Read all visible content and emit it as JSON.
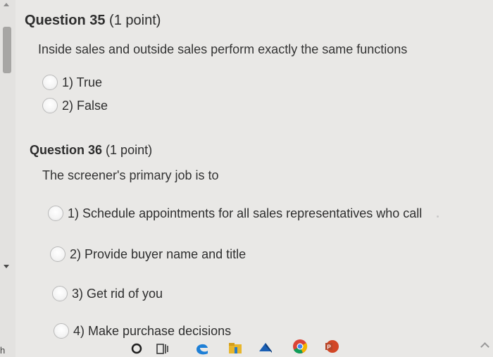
{
  "q35": {
    "title": "Question 35",
    "points": "(1 point)",
    "text": "Inside sales and outside sales perform exactly the same functions",
    "options": [
      {
        "label": "1) True"
      },
      {
        "label": "2) False"
      }
    ]
  },
  "q36": {
    "title": "Question 36",
    "points": "(1 point)",
    "text": "The screener's primary job is to",
    "options": [
      {
        "label": "1) Schedule appointments for all sales representatives who call"
      },
      {
        "label": "2) Provide buyer name and title"
      },
      {
        "label": "3) Get rid of you"
      },
      {
        "label": "4) Make purchase decisions"
      }
    ]
  },
  "edge_text": "h",
  "taskbar": {
    "icons": [
      "cortana-search-icon",
      "task-view-icon",
      "edge-icon",
      "file-explorer-icon",
      "mail-icon",
      "chrome-icon",
      "powerpoint-icon"
    ],
    "colors": {
      "edge": "#1e7fd6",
      "explorer": "#e8b62c",
      "mail": "#1a5fb4",
      "chrome_red": "#db4437",
      "powerpoint": "#d24726"
    }
  }
}
